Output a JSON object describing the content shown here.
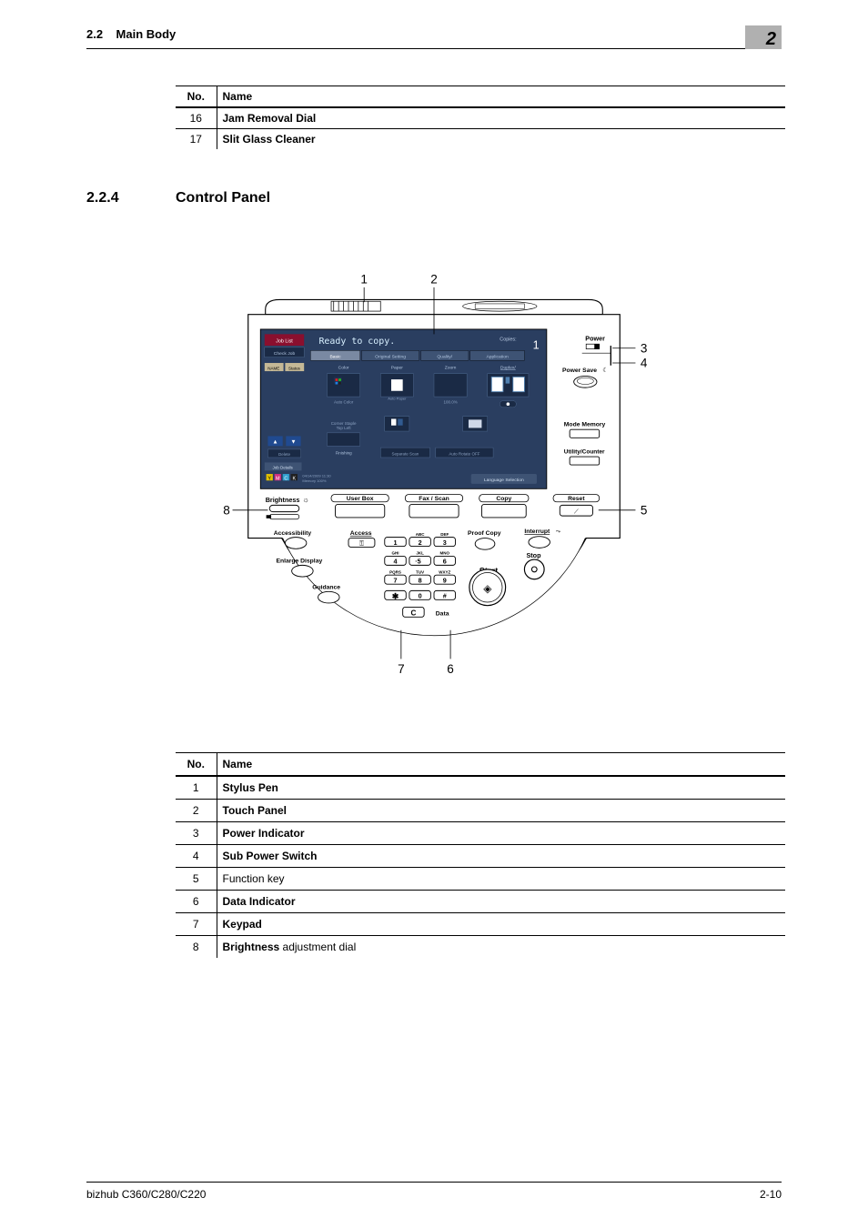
{
  "header": {
    "section_no": "2.2",
    "section_label": "Main Body",
    "chapter_badge": "2"
  },
  "table1": {
    "head_no": "No.",
    "head_name": "Name",
    "rows": [
      {
        "no": "16",
        "name": "Jam Removal Dial"
      },
      {
        "no": "17",
        "name": "Slit Glass Cleaner"
      }
    ]
  },
  "section": {
    "num": "2.2.4",
    "title": "Control Panel"
  },
  "diagram": {
    "callouts": [
      "1",
      "2",
      "3",
      "4",
      "5",
      "6",
      "7",
      "8"
    ],
    "screen": {
      "title": "Ready to copy.",
      "copies_label": "Copies:",
      "copies_value": "1",
      "tabs": [
        "Basic",
        "Original Setting",
        "Quality/",
        "Application"
      ],
      "left": [
        "Job List",
        "Check Job",
        "NAME",
        "Status",
        "Delete",
        "Job Details"
      ],
      "left_icons": [
        "▲",
        "▼"
      ],
      "mid_labels": [
        "Color",
        "Paper",
        "Zoom",
        "Duplex/"
      ],
      "small": [
        "Auto Color",
        "Auto Paper",
        "100.0%"
      ],
      "fin_labels": [
        "Corner Staple Top Left",
        "Finishing",
        "Separate Scan",
        "Auto Rotate OFF"
      ],
      "footer_left": "04/14/2009  11:30\nMemory   100%",
      "footer_right": "Language Selection"
    },
    "labels": {
      "power": "Power",
      "powersave": "Power Save",
      "modememory": "Mode Memory",
      "utility": "Utility/Counter",
      "brightness": "Brightness",
      "userbox": "User Box",
      "faxscan": "Fax / Scan",
      "copy": "Copy",
      "reset": "Reset",
      "accessibility": "Accessibility",
      "enlarge": "Enlarge Display",
      "guidance": "Guidance",
      "access": "Access",
      "proof": "Proof Copy",
      "interrupt": "Interrupt",
      "stop": "Stop",
      "start": "Start",
      "data": "Data",
      "keypad_letters": [
        "ABC",
        "DEF",
        "GHI",
        "JKL",
        "MNO",
        "PQRS",
        "TUV",
        "WXYZ"
      ]
    }
  },
  "table2": {
    "head_no": "No.",
    "head_name": "Name",
    "rows": [
      {
        "no": "1",
        "html": "<b>Stylus Pen</b>"
      },
      {
        "no": "2",
        "html": "<b>Touch Panel</b>"
      },
      {
        "no": "3",
        "html": "<b>Power Indicator</b>"
      },
      {
        "no": "4",
        "html": "<b>Sub Power Switch</b>"
      },
      {
        "no": "5",
        "html": "Function key"
      },
      {
        "no": "6",
        "html": "<b>Data Indicator</b>"
      },
      {
        "no": "7",
        "html": "<b>Keypad</b>"
      },
      {
        "no": "8",
        "html": "<b>Brightness</b> adjustment dial"
      }
    ]
  },
  "footer": {
    "left": "bizhub C360/C280/C220",
    "right": "2-10"
  }
}
